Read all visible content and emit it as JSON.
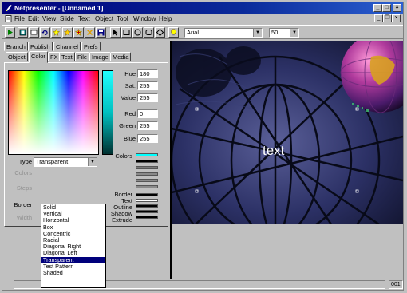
{
  "window": {
    "title": "Netpresenter - [Unnamed 1]",
    "buttons": {
      "minimize": "_",
      "maximize": "□",
      "close": "×"
    },
    "mdi_buttons": {
      "minimize": "_",
      "restore": "❐",
      "close": "×"
    }
  },
  "menu": [
    "File",
    "Edit",
    "View",
    "Slide",
    "Text",
    "Object",
    "Tool",
    "Window",
    "Help"
  ],
  "menu_underline": [
    "F",
    "E",
    "V",
    "S",
    "x",
    "O",
    "T",
    "W",
    "H"
  ],
  "toolbar": {
    "font": "Arial",
    "size": "50",
    "icons": [
      "play-icon",
      "slide-view-icon",
      "frame-icon",
      "loop-icon",
      "star-icon",
      "star-alt-icon",
      "plus-star-icon",
      "cross-icon",
      "save-icon",
      "pointer-icon",
      "rectangle-icon",
      "ellipse-icon",
      "rounded-rect-icon",
      "diamond-icon",
      "bulb-icon"
    ]
  },
  "tabs_row1": [
    "Branch",
    "Publish",
    "Channel",
    "Prefs"
  ],
  "tabs_row2": [
    "Object",
    "Color",
    "FX",
    "Text",
    "File",
    "Image",
    "Media"
  ],
  "active_tab": "Color",
  "color": {
    "fields": [
      {
        "label": "Hue",
        "value": "180"
      },
      {
        "label": "Sat.",
        "value": "255"
      },
      {
        "label": "Value",
        "value": "255"
      },
      {
        "label": "Red",
        "value": "0"
      },
      {
        "label": "Green",
        "value": "255"
      },
      {
        "label": "Blue",
        "value": "255"
      }
    ],
    "colors_label": "Colors",
    "swatch_labels": [
      "Border",
      "Text",
      "Outline",
      "Shadow",
      "Extrude"
    ],
    "type_label": "Type",
    "type_value": "Transparent",
    "hidden_labels": [
      "Colors",
      "Steps",
      "Border",
      "Width"
    ],
    "swatch_colors": {
      "accent": "#00ffff"
    }
  },
  "type_options": [
    "Solid",
    "Vertical",
    "Horizontal",
    "Box",
    "Concentric",
    "Radial",
    "Diagonal Right",
    "Diagonal Left",
    "Transparent",
    "Test Pattern",
    "Shaded"
  ],
  "canvas": {
    "text": "text"
  },
  "status": {
    "right": "001"
  }
}
